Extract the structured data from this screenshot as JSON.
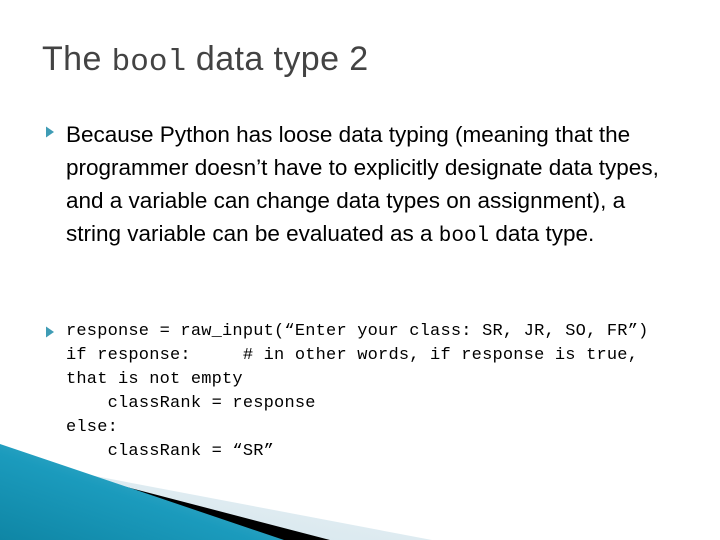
{
  "slide": {
    "title": {
      "before": "The ",
      "mono": "bool",
      "after": " data type 2"
    },
    "bullets": [
      {
        "marker": "triangle-right-bullet",
        "kind": "paragraph",
        "text_before": "Because Python has loose data typing (meaning that the programmer doesn’t have to explicitly designate data types, and a variable can change data types on assignment), a string variable can be evaluated as a ",
        "text_mono": "bool",
        "text_after": " data type."
      },
      {
        "marker": "triangle-right-bullet",
        "kind": "code",
        "code": "response = raw_input(“Enter your class: SR, JR, SO, FR”)\nif response:     # in other words, if response is true, that is not empty\n    classRank = response\nelse:\n    classRank = “SR”"
      }
    ],
    "colors": {
      "title_text": "#434343",
      "body_text": "#000000",
      "bullet_marker": "#3f9cb5",
      "accent_teal_dark": "#1289a7",
      "accent_teal_light": "#69c0d6",
      "accent_black": "#000000",
      "accent_pale": "#dce9ef",
      "background": "#ffffff"
    },
    "decoration": {
      "name": "bottom-left-diagonal-wedges"
    }
  }
}
